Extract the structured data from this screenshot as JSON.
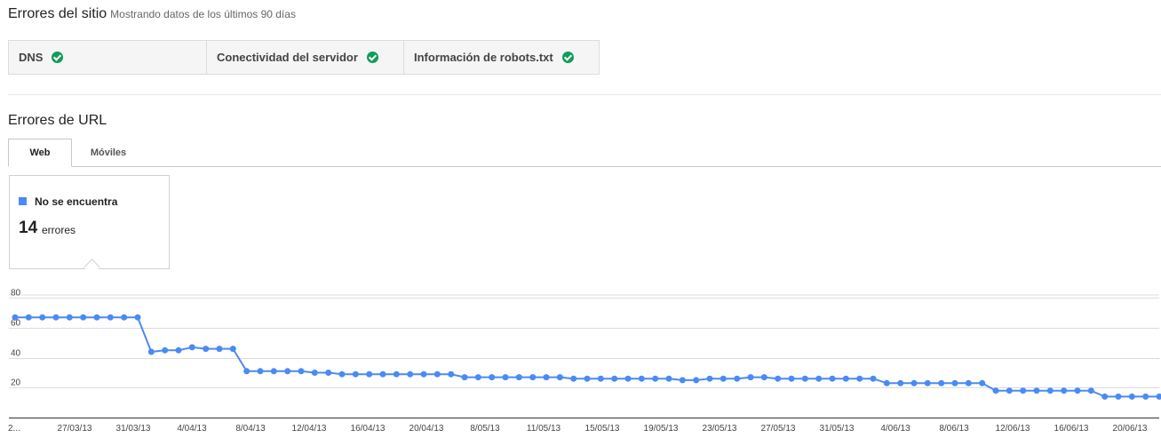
{
  "site_errors": {
    "title": "Errores del sitio",
    "subtitle": "Mostrando datos de los últimos 90 días",
    "checks": [
      {
        "label": "DNS",
        "status": "ok"
      },
      {
        "label": "Conectividad del servidor",
        "status": "ok"
      },
      {
        "label": "Información de robots.txt",
        "status": "ok"
      }
    ]
  },
  "url_errors": {
    "title": "Errores de URL",
    "tabs": [
      {
        "label": "Web",
        "active": true
      },
      {
        "label": "Móviles",
        "active": false
      }
    ],
    "legend": {
      "label": "No se encuentra",
      "count": "14",
      "unit": "errores",
      "color": "#4a8af4"
    }
  },
  "colors": {
    "series": "#4a8af4",
    "ok_check": "#0f9d58"
  },
  "chart_data": {
    "type": "line",
    "series": [
      {
        "name": "No se encuentra",
        "values": [
          67,
          67,
          67,
          67,
          67,
          67,
          67,
          67,
          67,
          67,
          44,
          45,
          45,
          47,
          46,
          46,
          46,
          31,
          31,
          31,
          31,
          31,
          30,
          30,
          29,
          29,
          29,
          29,
          29,
          29,
          29,
          29,
          29,
          27,
          27,
          27,
          27,
          27,
          27,
          27,
          27,
          26,
          26,
          26,
          26,
          26,
          26,
          26,
          26,
          25,
          25,
          26,
          26,
          26,
          27,
          27,
          26,
          26,
          26,
          26,
          26,
          26,
          26,
          26,
          23,
          23,
          23,
          23,
          23,
          23,
          23,
          23,
          18,
          18,
          18,
          18,
          18,
          18,
          18,
          18,
          14,
          14,
          14,
          14,
          14
        ]
      }
    ],
    "x_tick_labels": [
      "2...",
      "27/03/13",
      "31/03/13",
      "4/04/13",
      "8/04/13",
      "12/04/13",
      "16/04/13",
      "20/04/13",
      "8/05/13",
      "11/05/13",
      "15/05/13",
      "19/05/13",
      "23/05/13",
      "27/05/13",
      "31/05/13",
      "4/06/13",
      "8/06/13",
      "12/06/13",
      "16/06/13",
      "20/06/13"
    ],
    "yticks": [
      20,
      40,
      60,
      80
    ],
    "ylim": [
      0,
      82
    ],
    "grid": true
  }
}
